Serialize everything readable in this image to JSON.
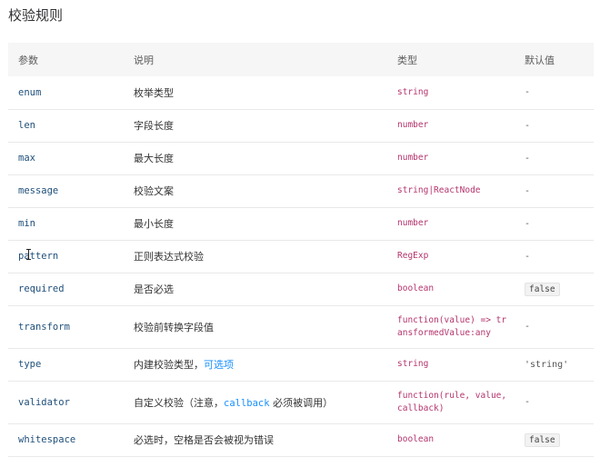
{
  "title": "校验规则",
  "columns": [
    "参数",
    "说明",
    "类型",
    "默认值"
  ],
  "rows": [
    {
      "param": "enum",
      "desc": "枚举类型",
      "type": "string",
      "default": "-"
    },
    {
      "param": "len",
      "desc": "字段长度",
      "type": "number",
      "default": "-"
    },
    {
      "param": "max",
      "desc": "最大长度",
      "type": "number",
      "default": "-"
    },
    {
      "param": "message",
      "desc": "校验文案",
      "type": "string|ReactNode",
      "default": "-"
    },
    {
      "param": "min",
      "desc": "最小长度",
      "type": "number",
      "default": "-"
    },
    {
      "param": "pattern",
      "desc": "正则表达式校验",
      "type": "RegExp",
      "default": "-"
    },
    {
      "param": "required",
      "desc": "是否必选",
      "type": "boolean",
      "default": "false"
    },
    {
      "param": "transform",
      "desc": "校验前转换字段值",
      "type": "function(value) => transformedValue:any",
      "default": "-"
    },
    {
      "param": "type",
      "desc": "内建校验类型，",
      "desc_link": "可选项",
      "type": "string",
      "default": "'string'"
    },
    {
      "param": "validator",
      "desc": "自定义校验（注意，",
      "desc_code": "callback",
      "desc_suffix": " 必须被调用）",
      "type": "function(rule, value, callback)",
      "default": "-"
    },
    {
      "param": "whitespace",
      "desc": "必选时，空格是否会被视为错误",
      "type": "boolean",
      "default": "false"
    }
  ]
}
